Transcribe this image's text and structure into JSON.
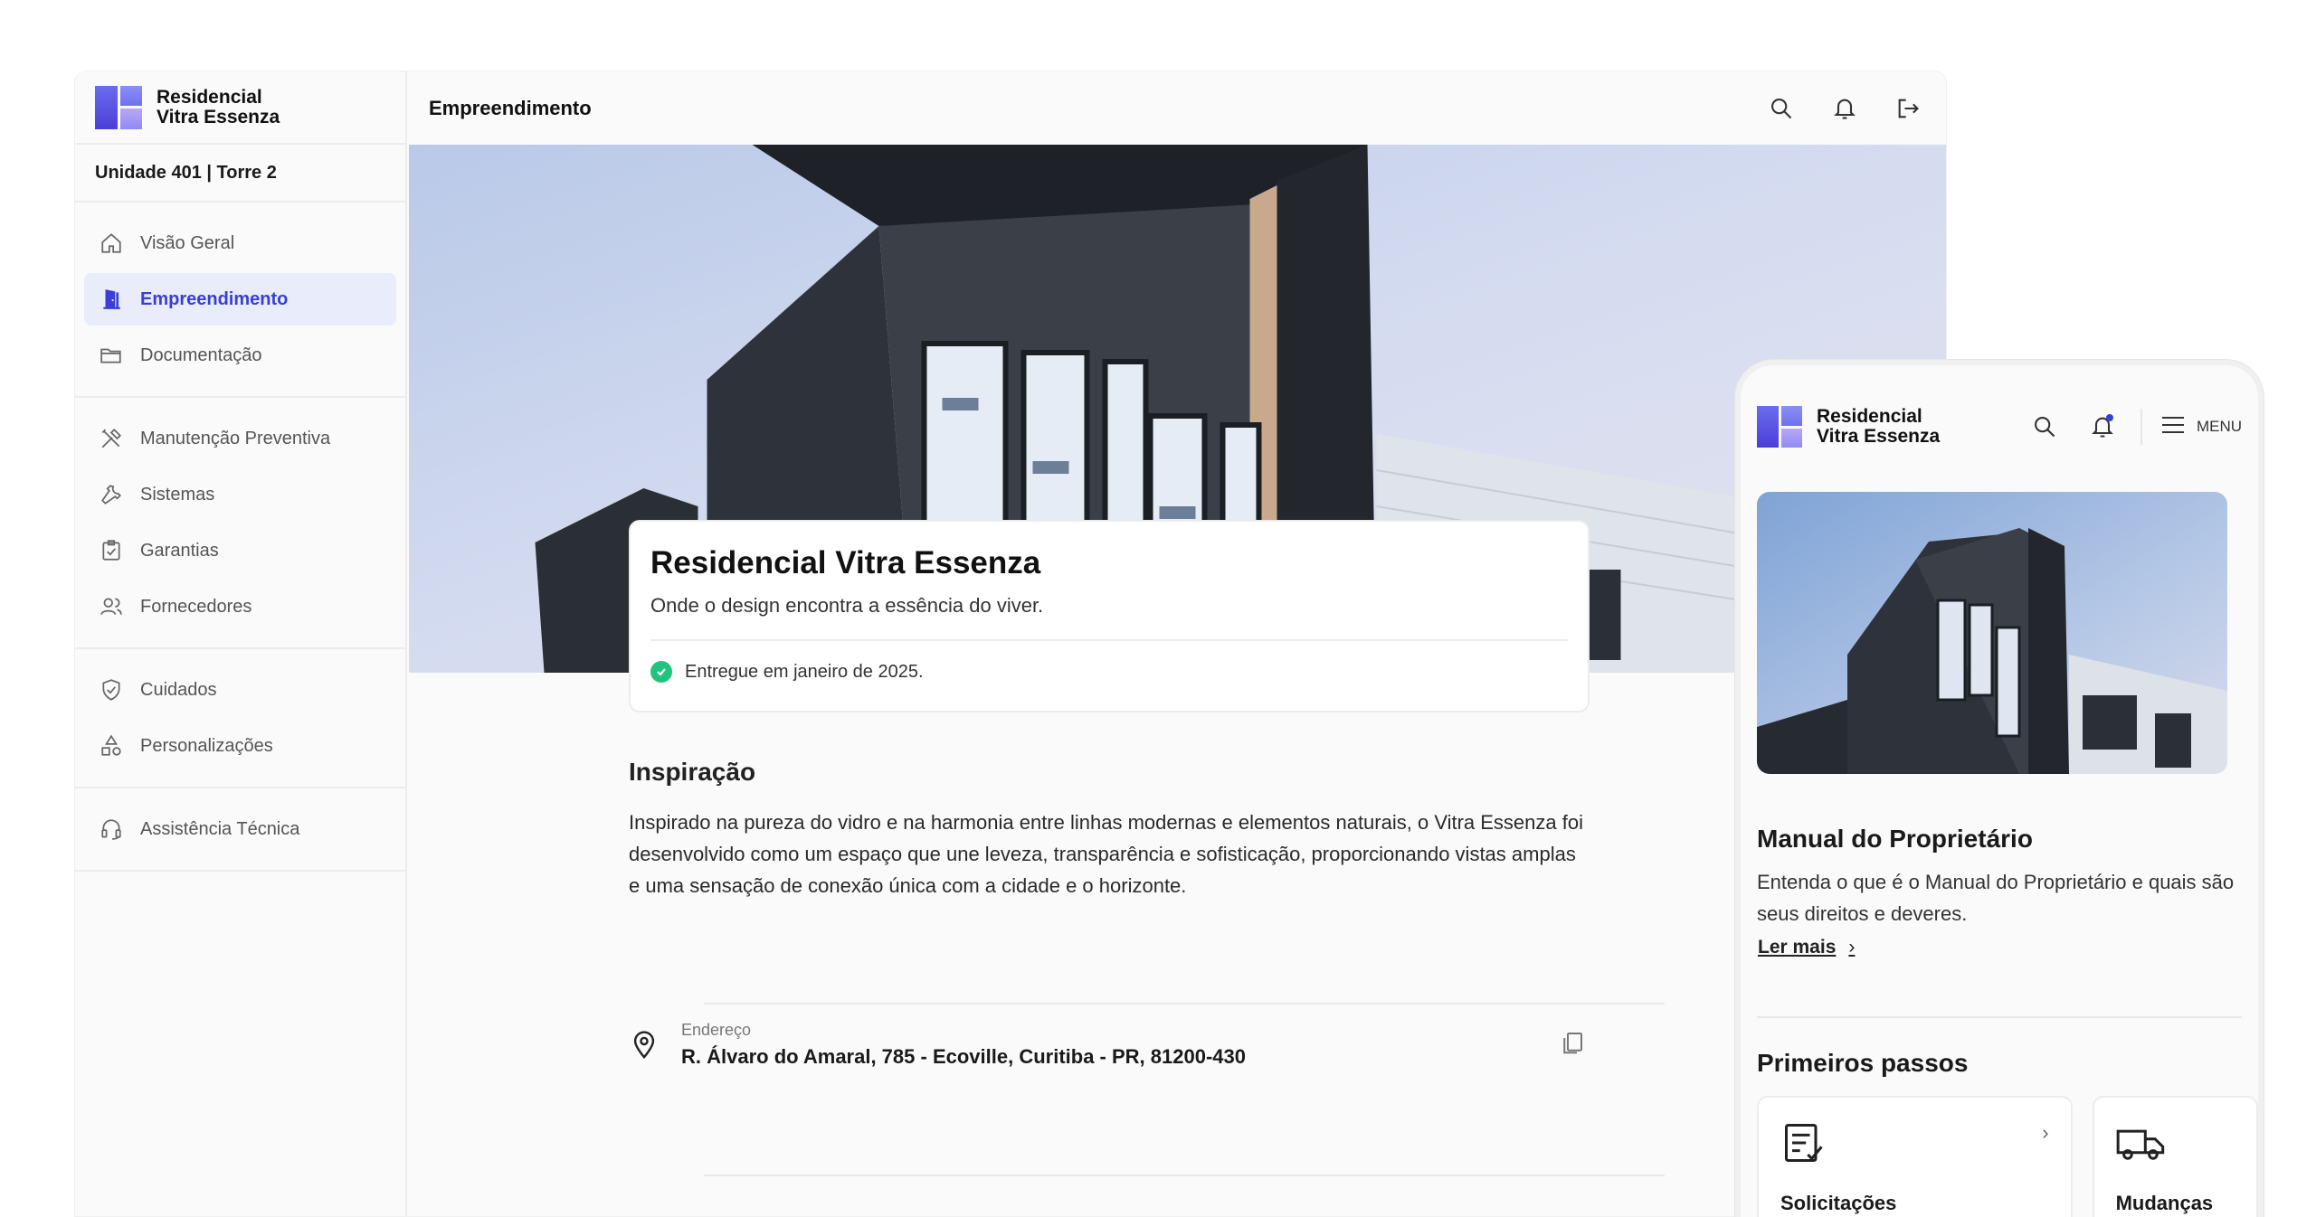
{
  "app": {
    "logo_line1": "Residencial",
    "logo_line2": "Vitra Essenza",
    "unit": "Unidade 401 | Torre 2",
    "accent_color": "#3a3ed6",
    "success_color": "#1fc47e"
  },
  "sidebar": {
    "groups": [
      [
        {
          "label": "Visão Geral",
          "icon": "home-icon"
        },
        {
          "label": "Empreendimento",
          "icon": "building-door-icon",
          "active": true
        },
        {
          "label": "Documentação",
          "icon": "folder-icon"
        }
      ],
      [
        {
          "label": "Manutenção Preventiva",
          "icon": "tools-icon"
        },
        {
          "label": "Sistemas",
          "icon": "wrench-icon"
        },
        {
          "label": "Garantias",
          "icon": "clipboard-check-icon"
        },
        {
          "label": "Fornecedores",
          "icon": "users-icon"
        }
      ],
      [
        {
          "label": "Cuidados",
          "icon": "shield-check-icon"
        },
        {
          "label": "Personalizações",
          "icon": "shapes-icon"
        }
      ],
      [
        {
          "label": "Assistência Técnica",
          "icon": "headset-icon"
        }
      ]
    ]
  },
  "topbar": {
    "title": "Empreendimento",
    "icons": [
      "search-icon",
      "bell-icon",
      "logout-icon"
    ]
  },
  "main": {
    "card": {
      "title": "Residencial Vitra Essenza",
      "subtitle": "Onde o design encontra a essência do viver.",
      "status": "Entregue em janeiro de 2025."
    },
    "inspiration": {
      "title": "Inspiração",
      "text": "Inspirado na pureza do vidro e na harmonia entre linhas modernas e elementos naturais, o Vitra Essenza foi desenvolvido como um espaço que une leveza, transparência e sofisticação, proporcionando vistas amplas e uma sensação de conexão única com a cidade e o horizonte."
    },
    "address": {
      "label": "Endereço",
      "value": "R. Álvaro do Amaral, 785 - Ecoville, Curitiba - PR, 81200-430"
    }
  },
  "mobile": {
    "menu_label": "MENU",
    "manual": {
      "title": "Manual do Proprietário",
      "text": "Entenda o que é o Manual do Proprietário e quais são seus direitos e deveres.",
      "link": "Ler mais"
    },
    "first_steps": {
      "title": "Primeiros passos",
      "cards": [
        {
          "label": "Solicitações",
          "icon": "checklist-icon"
        },
        {
          "label": "Mudanças",
          "icon": "truck-icon"
        }
      ]
    }
  }
}
